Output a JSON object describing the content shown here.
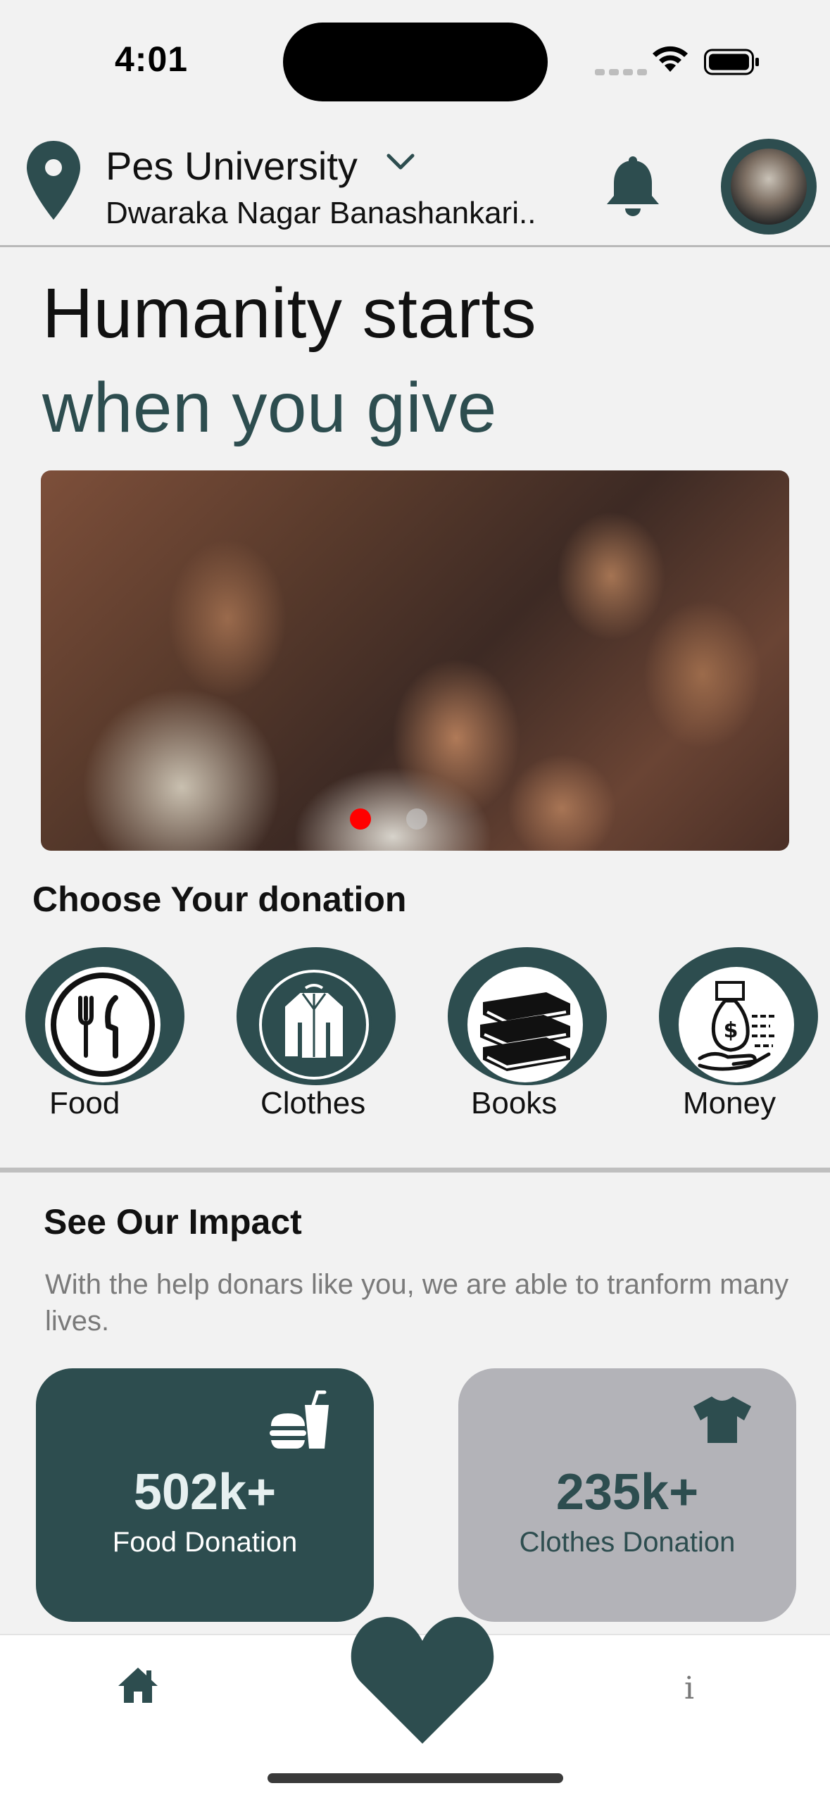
{
  "status_bar": {
    "time": "4:01"
  },
  "header": {
    "location_title": "Pes University",
    "location_subtitle": "Dwaraka Nagar Banashankari..",
    "icons": [
      "location-pin-icon",
      "chevron-down-icon",
      "bell-icon",
      "avatar"
    ]
  },
  "hero": {
    "line1": "Humanity starts",
    "line2": "when you give"
  },
  "carousel": {
    "active_index": 0,
    "count": 2
  },
  "donation": {
    "title": "Choose Your donation",
    "categories": [
      {
        "label": "Food",
        "icon": "food-plate-icon"
      },
      {
        "label": "Clothes",
        "icon": "jacket-icon"
      },
      {
        "label": "Books",
        "icon": "books-icon"
      },
      {
        "label": "Money",
        "icon": "money-icon"
      }
    ]
  },
  "impact": {
    "title": "See Our Impact",
    "description": "With the help donars like you, we are able to tranform many lives.",
    "cards": [
      {
        "value": "502k+",
        "label": "Food Donation",
        "icon": "fast-food-icon"
      },
      {
        "value": "235k+",
        "label": "Clothes Donation",
        "icon": "tshirt-icon"
      }
    ]
  },
  "tabbar": {
    "info_label": "i",
    "icons": [
      "home-icon",
      "heart-icon",
      "info-icon"
    ]
  },
  "colors": {
    "primary": "#2d4d4f",
    "background": "#f2f2f2",
    "card_secondary": "#b3b3b8",
    "carousel_dot_active": "#ff0000"
  }
}
